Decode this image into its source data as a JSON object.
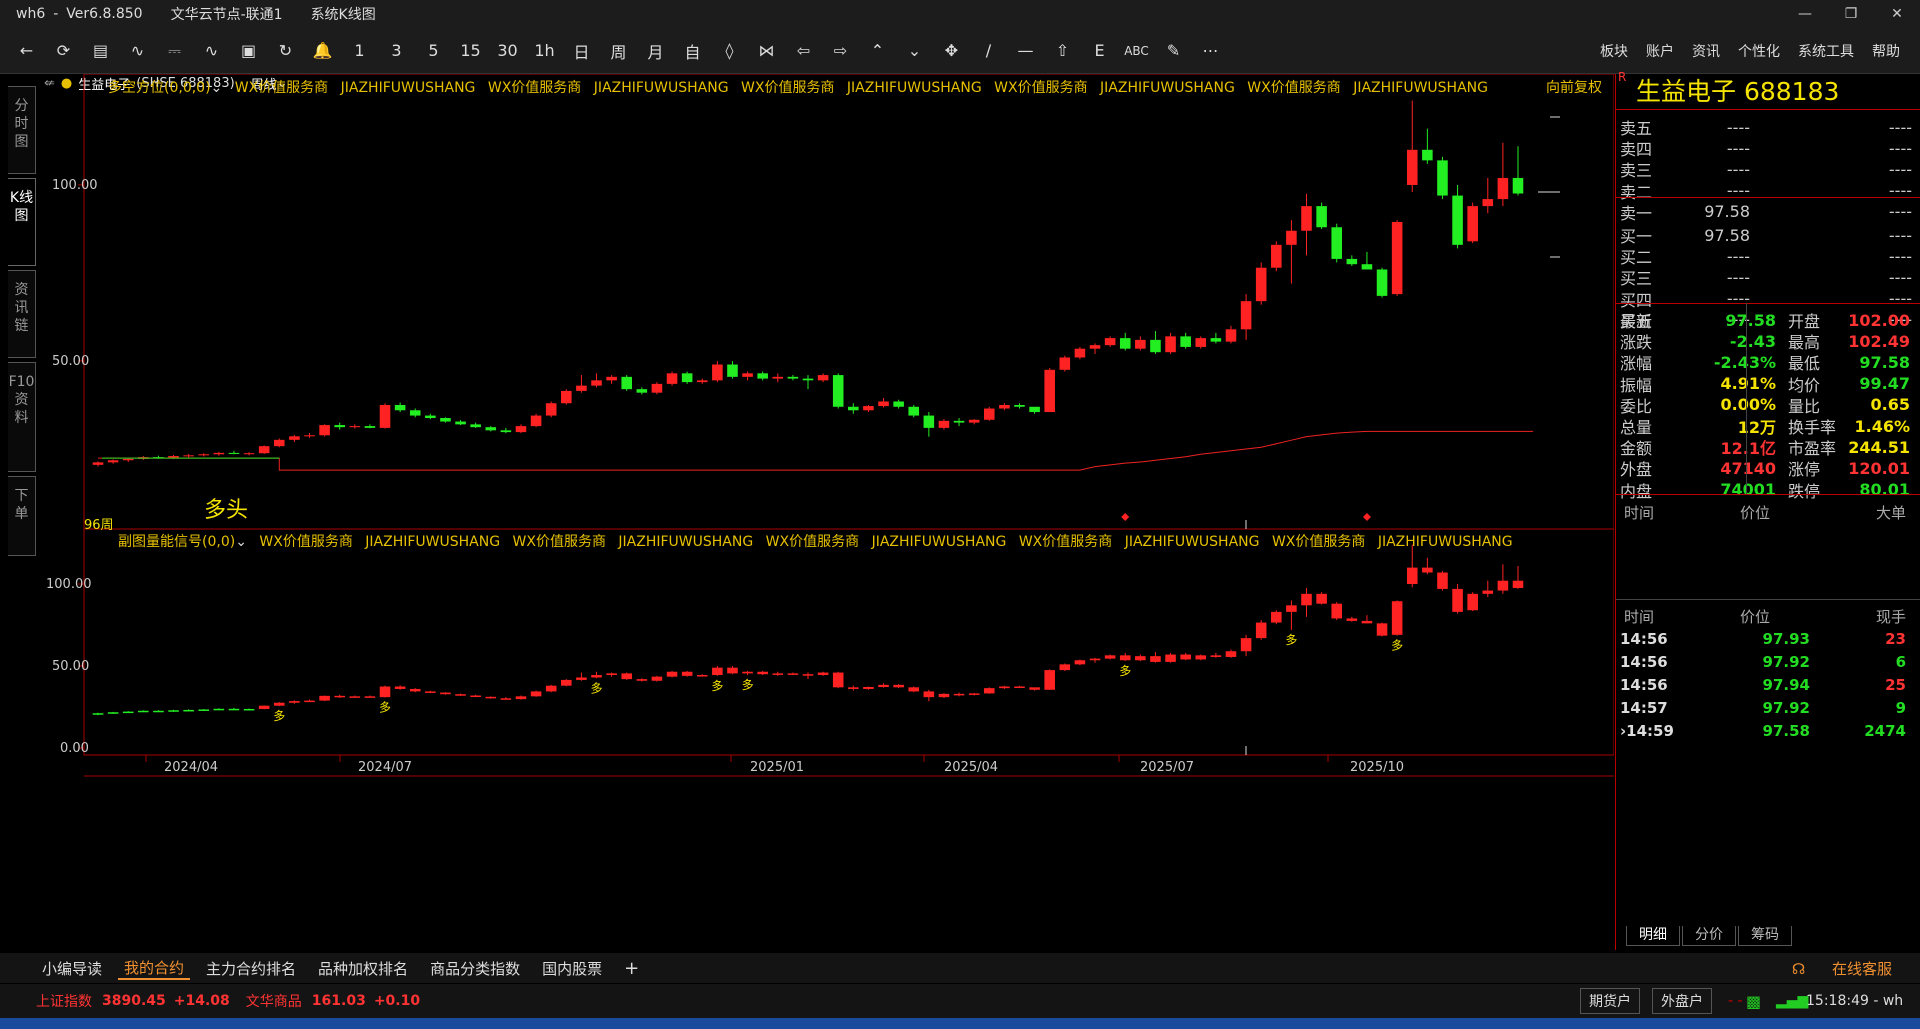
{
  "titlebar": {
    "app": "wh6",
    "version": "Ver6.8.850",
    "node": "文华云节点-联通1",
    "view": "系统K线图"
  },
  "menu": [
    "板块",
    "账户",
    "资讯",
    "个性化",
    "系统工具",
    "帮助"
  ],
  "toolbar_labels": [
    "1",
    "3",
    "5",
    "15",
    "30",
    "1h",
    "日",
    "周",
    "月",
    "自"
  ],
  "left_tabs": [
    "分时图",
    "K线图",
    "资讯链",
    "F10资料",
    "下单"
  ],
  "chart": {
    "symbol": "生益电子",
    "symbol_code": "(SHSE 688183)",
    "period": "周线",
    "main_indicator": "多空方位(0,0,0)",
    "ad": [
      "WX价值服务商",
      "JIAZHIFUWUSHANG",
      "WX价值服务商",
      "JIAZHIFUWUSHANG",
      "WX价值服务商",
      "JIAZHIFUWUSHANG",
      "WX价值服务商",
      "JIAZHIFUWUSHANG",
      "WX价值服务商",
      "JIAZHIFUWUSHANG"
    ],
    "adjust": "向前复权",
    "main_y_labels": [
      "100.00",
      "50.00"
    ],
    "signal_text": "多头",
    "period_count": "96周",
    "sub_indicator": "副图量能信号(0,0)",
    "sub_y_labels": [
      "100.00",
      "50.00",
      "0.00"
    ],
    "x_labels": [
      "2024/04",
      "2024/07",
      "2025/01",
      "2025/04",
      "2025/07",
      "2025/10"
    ],
    "sub_marker": "多"
  },
  "chart_data": {
    "type": "candlestick",
    "ylim": [
      18,
      128
    ],
    "candles": [
      [
        20.5,
        21.5,
        20.0,
        21.2
      ],
      [
        21.2,
        22.0,
        20.8,
        21.8
      ],
      [
        21.8,
        22.5,
        21.3,
        22.2
      ],
      [
        22.2,
        23.0,
        21.9,
        22.7
      ],
      [
        22.7,
        23.1,
        22.2,
        22.5
      ],
      [
        22.5,
        23.3,
        22.1,
        23.0
      ],
      [
        23.0,
        23.6,
        22.6,
        23.2
      ],
      [
        23.2,
        23.8,
        22.9,
        23.5
      ],
      [
        23.5,
        24.2,
        23.1,
        23.9
      ],
      [
        23.9,
        24.5,
        23.5,
        23.6
      ],
      [
        23.6,
        24.1,
        23.2,
        23.8
      ],
      [
        23.8,
        26.0,
        23.6,
        25.8
      ],
      [
        25.8,
        28.0,
        25.5,
        27.6
      ],
      [
        27.6,
        29.0,
        27.0,
        28.6
      ],
      [
        28.6,
        29.5,
        28.2,
        28.9
      ],
      [
        28.9,
        32.0,
        28.6,
        31.8
      ],
      [
        31.8,
        32.5,
        30.5,
        31.2
      ],
      [
        31.2,
        32.0,
        30.8,
        31.5
      ],
      [
        31.5,
        32.0,
        30.9,
        31.0
      ],
      [
        31.0,
        38.0,
        30.8,
        37.5
      ],
      [
        37.5,
        38.2,
        35.5,
        36.0
      ],
      [
        36.0,
        36.5,
        34.0,
        34.5
      ],
      [
        34.5,
        35.0,
        33.5,
        33.8
      ],
      [
        33.8,
        34.0,
        32.5,
        32.8
      ],
      [
        32.8,
        33.2,
        31.8,
        32.0
      ],
      [
        32.0,
        32.5,
        31.0,
        31.2
      ],
      [
        31.2,
        31.5,
        30.0,
        30.3
      ],
      [
        30.3,
        31.0,
        29.5,
        29.8
      ],
      [
        29.8,
        32.0,
        29.5,
        31.5
      ],
      [
        31.5,
        35.0,
        31.2,
        34.5
      ],
      [
        34.5,
        38.5,
        34.0,
        38.0
      ],
      [
        38.0,
        42.0,
        37.6,
        41.5
      ],
      [
        41.5,
        46.0,
        41.0,
        43.0
      ],
      [
        43.0,
        46.5,
        42.5,
        44.5
      ],
      [
        44.5,
        46.0,
        43.5,
        45.5
      ],
      [
        45.5,
        46.0,
        41.5,
        42.0
      ],
      [
        42.0,
        42.5,
        40.5,
        41.0
      ],
      [
        41.0,
        44.0,
        40.5,
        43.5
      ],
      [
        43.5,
        47.0,
        43.0,
        46.5
      ],
      [
        46.5,
        47.0,
        43.5,
        44.0
      ],
      [
        44.0,
        45.0,
        43.5,
        44.5
      ],
      [
        44.5,
        50.0,
        44.0,
        49.0
      ],
      [
        49.0,
        50.0,
        45.0,
        45.5
      ],
      [
        45.5,
        47.0,
        44.5,
        46.5
      ],
      [
        46.5,
        47.0,
        44.5,
        45.0
      ],
      [
        45.0,
        46.5,
        44.0,
        45.5
      ],
      [
        45.5,
        46.0,
        44.5,
        45.0
      ],
      [
        45.0,
        46.0,
        42.0,
        44.5
      ],
      [
        44.5,
        46.5,
        44.0,
        46.0
      ],
      [
        46.0,
        46.5,
        36.5,
        37.0
      ],
      [
        37.0,
        38.0,
        35.0,
        36.0
      ],
      [
        36.0,
        37.5,
        35.5,
        37.2
      ],
      [
        37.2,
        39.5,
        36.8,
        38.5
      ],
      [
        38.5,
        39.0,
        36.5,
        37.0
      ],
      [
        37.0,
        37.5,
        34.0,
        34.5
      ],
      [
        34.5,
        35.5,
        28.5,
        31.0
      ],
      [
        31.0,
        33.5,
        30.5,
        33.0
      ],
      [
        33.0,
        33.8,
        31.5,
        32.5
      ],
      [
        32.5,
        33.5,
        32.0,
        33.3
      ],
      [
        33.3,
        37.0,
        33.0,
        36.5
      ],
      [
        36.5,
        38.0,
        36.0,
        37.5
      ],
      [
        37.5,
        38.0,
        36.5,
        37.0
      ],
      [
        37.0,
        36.8,
        35.0,
        35.5
      ],
      [
        35.5,
        48.0,
        35.5,
        47.5
      ],
      [
        47.5,
        51.5,
        47.0,
        51.0
      ],
      [
        51.0,
        54.0,
        50.5,
        53.5
      ],
      [
        53.5,
        55.0,
        52.0,
        54.5
      ],
      [
        54.5,
        57.0,
        54.0,
        56.5
      ],
      [
        56.5,
        58.0,
        53.0,
        53.5
      ],
      [
        53.5,
        57.0,
        53.0,
        56.0
      ],
      [
        56.0,
        58.5,
        52.0,
        52.5
      ],
      [
        52.5,
        58.0,
        52.0,
        57.0
      ],
      [
        57.0,
        58.0,
        53.5,
        54.0
      ],
      [
        54.0,
        57.0,
        53.5,
        56.5
      ],
      [
        56.5,
        58.0,
        55.0,
        55.5
      ],
      [
        55.5,
        60.0,
        55.0,
        59.0
      ],
      [
        59.0,
        69.0,
        56.0,
        67.0
      ],
      [
        67.0,
        78.0,
        66.0,
        76.5
      ],
      [
        76.5,
        84.0,
        75.5,
        83.0
      ],
      [
        83.0,
        90.0,
        72.0,
        87.0
      ],
      [
        87.0,
        97.5,
        80.0,
        94.0
      ],
      [
        94.0,
        95.0,
        87.5,
        88.0
      ],
      [
        88.0,
        89.0,
        78.0,
        79.0
      ],
      [
        79.0,
        80.0,
        77.0,
        77.5
      ],
      [
        77.5,
        81.0,
        76.0,
        76.0
      ],
      [
        76.0,
        76.5,
        68.0,
        68.5
      ],
      [
        69.0,
        90.0,
        68.5,
        89.5
      ],
      [
        100.0,
        124.0,
        98.0,
        110.0
      ],
      [
        110.0,
        116.0,
        106.0,
        107.0
      ],
      [
        107.0,
        108.0,
        96.0,
        97.0
      ],
      [
        97.0,
        100.0,
        82.0,
        83.0
      ],
      [
        84.0,
        95.0,
        83.5,
        94.0
      ],
      [
        94.0,
        102.0,
        92.0,
        96.0
      ],
      [
        96.0,
        112.0,
        94.0,
        102.0
      ],
      [
        102.0,
        111.0,
        97.0,
        97.58
      ]
    ],
    "line_series": {
      "name": "多空方位",
      "points": [
        [
          0,
          22.4
        ],
        [
          12,
          22.4
        ],
        [
          12,
          19.0
        ],
        [
          65,
          19.0
        ],
        [
          66,
          20.0
        ],
        [
          67,
          20.5
        ],
        [
          68,
          21.0
        ],
        [
          69,
          21.3
        ],
        [
          70,
          21.8
        ],
        [
          71,
          22.3
        ],
        [
          72,
          22.8
        ],
        [
          73,
          23.5
        ],
        [
          74,
          24.0
        ],
        [
          75,
          24.5
        ],
        [
          76,
          25.0
        ],
        [
          77,
          25.5
        ],
        [
          78,
          26.5
        ],
        [
          79,
          27.5
        ],
        [
          80,
          28.5
        ],
        [
          81,
          29.0
        ],
        [
          82,
          29.5
        ],
        [
          83,
          29.8
        ],
        [
          84,
          30.0
        ],
        [
          95,
          30.0
        ]
      ]
    },
    "signals": [
      {
        "type": "diamond",
        "index": 68
      },
      {
        "type": "diamond",
        "index": 84
      }
    ]
  },
  "order_book": {
    "title": "生益电子  688183",
    "asks": [
      {
        "label": "卖五",
        "price": "----",
        "vol": "----"
      },
      {
        "label": "卖四",
        "price": "----",
        "vol": "----"
      },
      {
        "label": "卖三",
        "price": "----",
        "vol": "----"
      },
      {
        "label": "卖二",
        "price": "----",
        "vol": "----"
      },
      {
        "label": "卖一",
        "price": "97.58",
        "vol": "----"
      }
    ],
    "bids": [
      {
        "label": "买一",
        "price": "97.58",
        "vol": "----"
      },
      {
        "label": "买二",
        "price": "----",
        "vol": "----"
      },
      {
        "label": "买三",
        "price": "----",
        "vol": "----"
      },
      {
        "label": "买四",
        "price": "----",
        "vol": "----"
      },
      {
        "label": "买五",
        "price": "----",
        "vol": "----"
      }
    ]
  },
  "stats": [
    {
      "k": "最新",
      "v": "97.58",
      "vc": "#22dd22",
      "k2": "开盘",
      "v2": "102.00",
      "v2c": "#ff3333"
    },
    {
      "k": "涨跌",
      "v": "-2.43",
      "vc": "#22dd22",
      "k2": "最高",
      "v2": "102.49",
      "v2c": "#ff3333"
    },
    {
      "k": "涨幅",
      "v": "-2.43%",
      "vc": "#22dd22",
      "k2": "最低",
      "v2": "97.58",
      "v2c": "#22dd22"
    },
    {
      "k": "振幅",
      "v": "4.91%",
      "vc": "#f5e300",
      "k2": "均价",
      "v2": "99.47",
      "v2c": "#22dd22"
    },
    {
      "k": "委比",
      "v": "0.00%",
      "vc": "#f5e300",
      "k2": "量比",
      "v2": "0.65",
      "v2c": "#f5e300"
    },
    {
      "k": "总量",
      "v": "12万",
      "vc": "#f5e300",
      "k2": "换手率",
      "v2": "1.46%",
      "v2c": "#f5e300"
    },
    {
      "k": "金额",
      "v": "12.1亿",
      "vc": "#ff3333",
      "k2": "市盈率",
      "v2": "244.51",
      "v2c": "#f5e300"
    },
    {
      "k": "外盘",
      "v": "47140",
      "vc": "#ff3333",
      "k2": "涨停",
      "v2": "120.01",
      "v2c": "#ff3333"
    },
    {
      "k": "内盘",
      "v": "74001",
      "vc": "#22dd22",
      "k2": "跌停",
      "v2": "80.01",
      "v2c": "#22dd22"
    }
  ],
  "big_deal_header": {
    "time": "时间",
    "price": "价位",
    "vol": "大单"
  },
  "ticks_header": {
    "time": "时间",
    "price": "价位",
    "vol": "现手"
  },
  "ticks": [
    {
      "time": "14:56",
      "price": "97.93",
      "vol": "23",
      "vc": "#ff3333"
    },
    {
      "time": "14:56",
      "price": "97.92",
      "vol": "6",
      "vc": "#22dd22"
    },
    {
      "time": "14:56",
      "price": "97.94",
      "vol": "25",
      "vc": "#ff3333"
    },
    {
      "time": "14:57",
      "price": "97.92",
      "vol": "9",
      "vc": "#22dd22"
    },
    {
      "time": "›14:59",
      "price": "97.58",
      "vol": "2474",
      "vc": "#22dd22"
    }
  ],
  "right_tabs": [
    "明细",
    "分价",
    "筹码"
  ],
  "bottom_tabs": [
    "小编导读",
    "我的合约",
    "主力合约排名",
    "品种加权排名",
    "商品分类指数",
    "国内股票",
    "+"
  ],
  "customer_service": "在线客服",
  "status": {
    "idx1_name": "上证指数",
    "idx1_val": "3890.45",
    "idx1_chg": "+14.08",
    "idx2_name": "文华商品",
    "idx2_val": "161.03",
    "idx2_chg": "+0.10",
    "btn1": "期货户",
    "btn2": "外盘户",
    "time": "15:18:49 - wh"
  }
}
